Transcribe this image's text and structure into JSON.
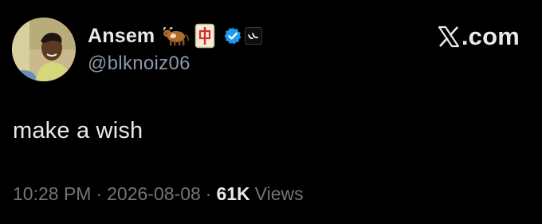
{
  "author": {
    "display_name": "Ansem",
    "handle": "@blknoiz06",
    "emojis": [
      "ox-emoji",
      "mahjong-red-dragon-emoji"
    ],
    "verified": true,
    "affiliate_badge": "affiliate-logo-icon"
  },
  "site": {
    "logo_icon": "x-logo-icon",
    "domain": ".com"
  },
  "tweet": {
    "text": "make a wish"
  },
  "meta": {
    "time": "10:28 PM",
    "separator": "·",
    "date": "2026-08-08",
    "views_count": "61K",
    "views_label": "Views"
  },
  "colors": {
    "background": "#000000",
    "text_primary": "#e7e9ea",
    "text_secondary": "#8b98a5",
    "text_muted": "#6e767d",
    "verified_blue": "#1d9bf0"
  }
}
